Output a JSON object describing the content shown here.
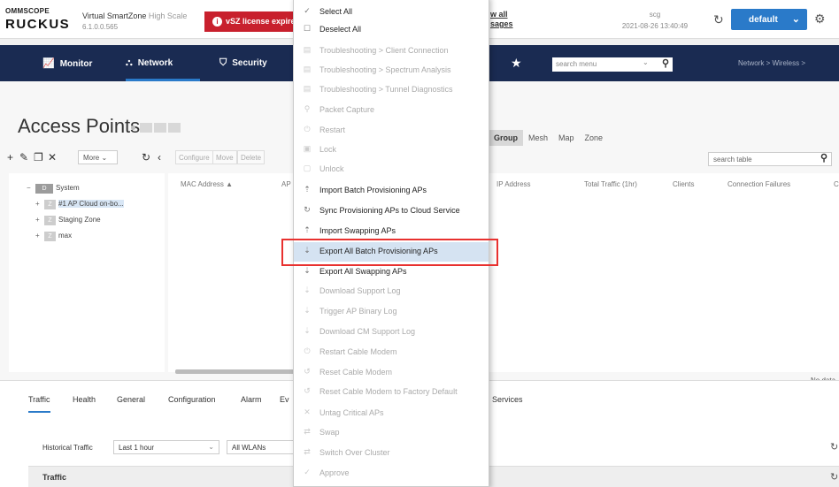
{
  "header": {
    "logo_top": "OMMSCOPE",
    "logo_main": "RUCKUS",
    "product_name": "Virtual SmartZone",
    "product_edition": "High Scale",
    "version": "6.1.0.0.565",
    "license_alert": "vSZ license expired",
    "view_all_line1": "w all",
    "view_all_line2": "sages",
    "cluster_name": "scg",
    "datetime": "2021-08-26 13:40:49",
    "domain": "default"
  },
  "nav": {
    "items": [
      {
        "label": "Monitor",
        "icon": "chart-icon"
      },
      {
        "label": "Network",
        "icon": "network-icon"
      },
      {
        "label": "Security",
        "icon": "shield-icon"
      }
    ],
    "search_placeholder": "search menu",
    "breadcrumb": "Network  >  Wireless  >"
  },
  "page": {
    "title": "Access Points",
    "view_tabs": [
      "Group",
      "Mesh",
      "Map",
      "Zone"
    ],
    "toolbar": {
      "more_label": "More",
      "configure": "Configure",
      "move": "Move",
      "delete": "Delete"
    },
    "table_search_placeholder": "search table",
    "tree": [
      {
        "exp": "−",
        "tag": "D",
        "label": "System"
      },
      {
        "exp": "+",
        "tag": "Z",
        "label": "#1 AP Cloud on-bo..."
      },
      {
        "exp": "+",
        "tag": "Z",
        "label": "Staging Zone"
      },
      {
        "exp": "+",
        "tag": "Z",
        "label": "max"
      }
    ],
    "columns": [
      "MAC Address ▲",
      "AP",
      "IP Address",
      "Total Traffic (1hr)",
      "Clients",
      "Connection Failures",
      "C"
    ],
    "no_data": "No data"
  },
  "bottom": {
    "tabs": [
      "Traffic",
      "Health",
      "General",
      "Configuration",
      "Alarm",
      "Ev",
      "Services"
    ],
    "historical_label": "Historical Traffic",
    "time_range": "Last 1 hour",
    "wlan_filter": "All WLANs",
    "traffic_title": "Traffic"
  },
  "context_menu": {
    "items": [
      {
        "label": "Select All",
        "icon": "check-icon",
        "enabled": true
      },
      {
        "label": "Deselect All",
        "icon": "checkbox-icon",
        "enabled": true
      },
      {
        "label": "Troubleshooting > Client Connection",
        "icon": "troubleshoot-icon",
        "enabled": false
      },
      {
        "label": "Troubleshooting > Spectrum Analysis",
        "icon": "troubleshoot-icon",
        "enabled": false
      },
      {
        "label": "Troubleshooting > Tunnel Diagnostics",
        "icon": "troubleshoot-icon",
        "enabled": false
      },
      {
        "label": "Packet Capture",
        "icon": "search-icon",
        "enabled": false
      },
      {
        "label": "Restart",
        "icon": "power-icon",
        "enabled": false
      },
      {
        "label": "Lock",
        "icon": "lock-icon",
        "enabled": false
      },
      {
        "label": "Unlock",
        "icon": "unlock-icon",
        "enabled": false
      },
      {
        "label": "Import Batch Provisioning APs",
        "icon": "upload-icon",
        "enabled": true
      },
      {
        "label": "Sync Provisioning APs to Cloud Service",
        "icon": "sync-icon",
        "enabled": true
      },
      {
        "label": "Import Swapping APs",
        "icon": "upload-icon",
        "enabled": true
      },
      {
        "label": "Export All Batch Provisioning APs",
        "icon": "download-icon",
        "enabled": true,
        "highlighted": true
      },
      {
        "label": "Export All Swapping APs",
        "icon": "download-icon",
        "enabled": true
      },
      {
        "label": "Download Support Log",
        "icon": "download-icon",
        "enabled": false
      },
      {
        "label": "Trigger AP Binary Log",
        "icon": "download-icon",
        "enabled": false
      },
      {
        "label": "Download CM Support Log",
        "icon": "download-icon",
        "enabled": false
      },
      {
        "label": "Restart Cable Modem",
        "icon": "power-icon",
        "enabled": false
      },
      {
        "label": "Reset Cable Modem",
        "icon": "reset-icon",
        "enabled": false
      },
      {
        "label": "Reset Cable Modem to Factory Default",
        "icon": "reset-icon",
        "enabled": false
      },
      {
        "label": "Untag Critical APs",
        "icon": "close-icon",
        "enabled": false
      },
      {
        "label": "Swap",
        "icon": "swap-icon",
        "enabled": false
      },
      {
        "label": "Switch Over Cluster",
        "icon": "swap-icon",
        "enabled": false
      },
      {
        "label": "Approve",
        "icon": "check-icon",
        "enabled": false
      }
    ]
  },
  "colors": {
    "nav_bg": "#1a2b52",
    "accent": "#2a7ac9",
    "alert": "#c8202d",
    "highlight_box": "#e8312f",
    "menu_highlight": "#d5e3f2"
  }
}
